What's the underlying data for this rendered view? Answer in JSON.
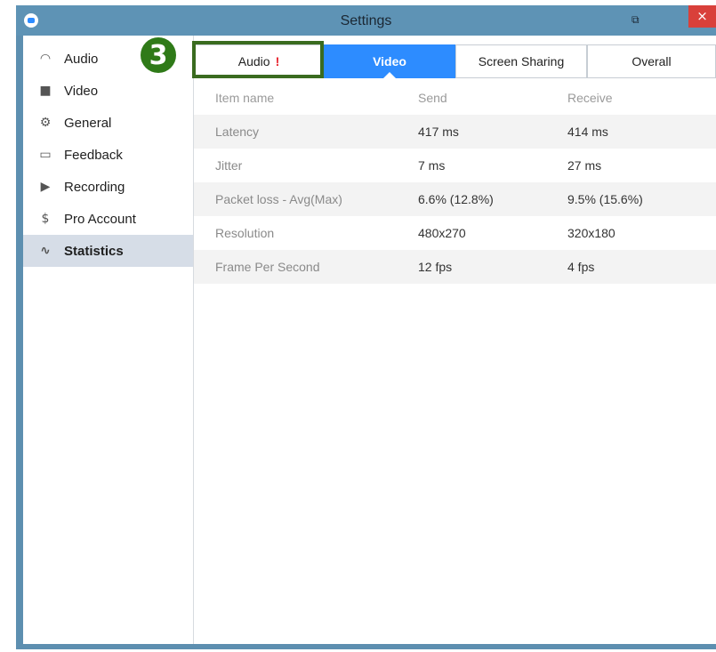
{
  "window": {
    "title": "Settings",
    "close_label": "×",
    "snap_icon": "snap-icon"
  },
  "annotation": {
    "step_number": "3",
    "color": "#2f7a18"
  },
  "sidebar": {
    "items": [
      {
        "label": "Audio",
        "icon": "headphones-icon"
      },
      {
        "label": "Video",
        "icon": "camera-icon"
      },
      {
        "label": "General",
        "icon": "gears-icon"
      },
      {
        "label": "Feedback",
        "icon": "chat-icon"
      },
      {
        "label": "Recording",
        "icon": "record-icon"
      },
      {
        "label": "Pro Account",
        "icon": "dollar-icon"
      },
      {
        "label": "Statistics",
        "icon": "pulse-icon",
        "active": true
      }
    ]
  },
  "tabs": [
    {
      "label": "Audio",
      "warning": "!"
    },
    {
      "label": "Video",
      "active": true
    },
    {
      "label": "Screen Sharing"
    },
    {
      "label": "Overall"
    }
  ],
  "table": {
    "headers": [
      "Item name",
      "Send",
      "Receive"
    ],
    "rows": [
      [
        "Latency",
        "417 ms",
        "414 ms"
      ],
      [
        "Jitter",
        "7 ms",
        "27 ms"
      ],
      [
        "Packet loss - Avg(Max)",
        "6.6% (12.8%)",
        "9.5% (15.6%)"
      ],
      [
        "Resolution",
        "480x270",
        "320x180"
      ],
      [
        "Frame Per Second",
        "12 fps",
        "4 fps"
      ]
    ]
  },
  "colors": {
    "accent": "#2d8cff",
    "titlebar": "#5e93b5",
    "close": "#d9403a",
    "warning": "#e8232d"
  }
}
